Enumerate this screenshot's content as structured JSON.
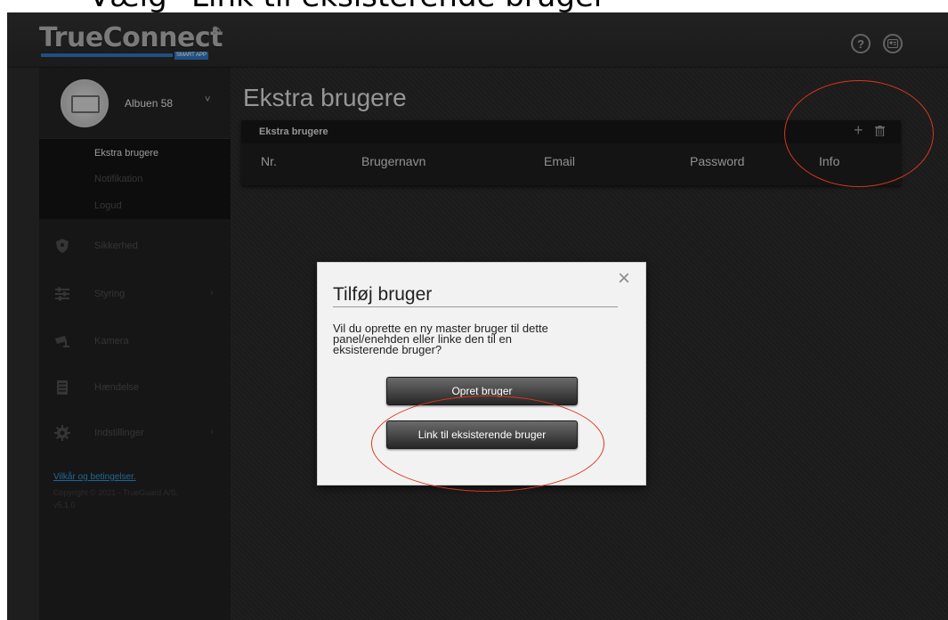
{
  "caption": {
    "text": "Vælg “Link til eksisterende bruger”"
  },
  "header": {
    "logo_text": "TrueConnect",
    "logo_sub": "SMART APP",
    "help_icon": "question-icon",
    "user_icon": "user-card-icon"
  },
  "sidebar": {
    "profile": {
      "name": "Albuen 58",
      "caret": "˅"
    },
    "submenu": [
      {
        "label": "Ekstra brugere",
        "active": true
      },
      {
        "label": "Notifikation",
        "active": false
      },
      {
        "label": "Logud",
        "active": false
      }
    ],
    "nav": [
      {
        "label": "Sikkerhed",
        "icon": "shield-icon",
        "chevron": ""
      },
      {
        "label": "Styring",
        "icon": "sliders-icon",
        "chevron": "›"
      },
      {
        "label": "Kamera",
        "icon": "camera-icon",
        "chevron": ""
      },
      {
        "label": "Hændelse",
        "icon": "list-icon",
        "chevron": ""
      },
      {
        "label": "Indstillinger",
        "icon": "gear-icon",
        "chevron": "›"
      }
    ],
    "terms_link": "Vilkår og betingelser.",
    "copyright": "Copyright © 2021 - TrueGuard A/S.",
    "version": "v5.1.0"
  },
  "main": {
    "title": "Ekstra brugere",
    "panel": {
      "title": "Ekstra brugere",
      "add_label": "+",
      "columns": [
        "Nr.",
        "Brugernavn",
        "Email",
        "Password",
        "Info"
      ]
    }
  },
  "dialog": {
    "title": "Tilføj bruger",
    "close_label": "×",
    "message_lines": [
      "Vil du oprette en ny master bruger til dette",
      "panel/enehden eller linke den til en",
      "eksisterende bruger?"
    ],
    "create_button": "Opret bruger",
    "link_button": "Link til eksisterende bruger"
  },
  "colors": {
    "accent_blue": "#2d6fb5",
    "link_blue": "#2f8fd0",
    "annotation_red": "#d9361f"
  }
}
